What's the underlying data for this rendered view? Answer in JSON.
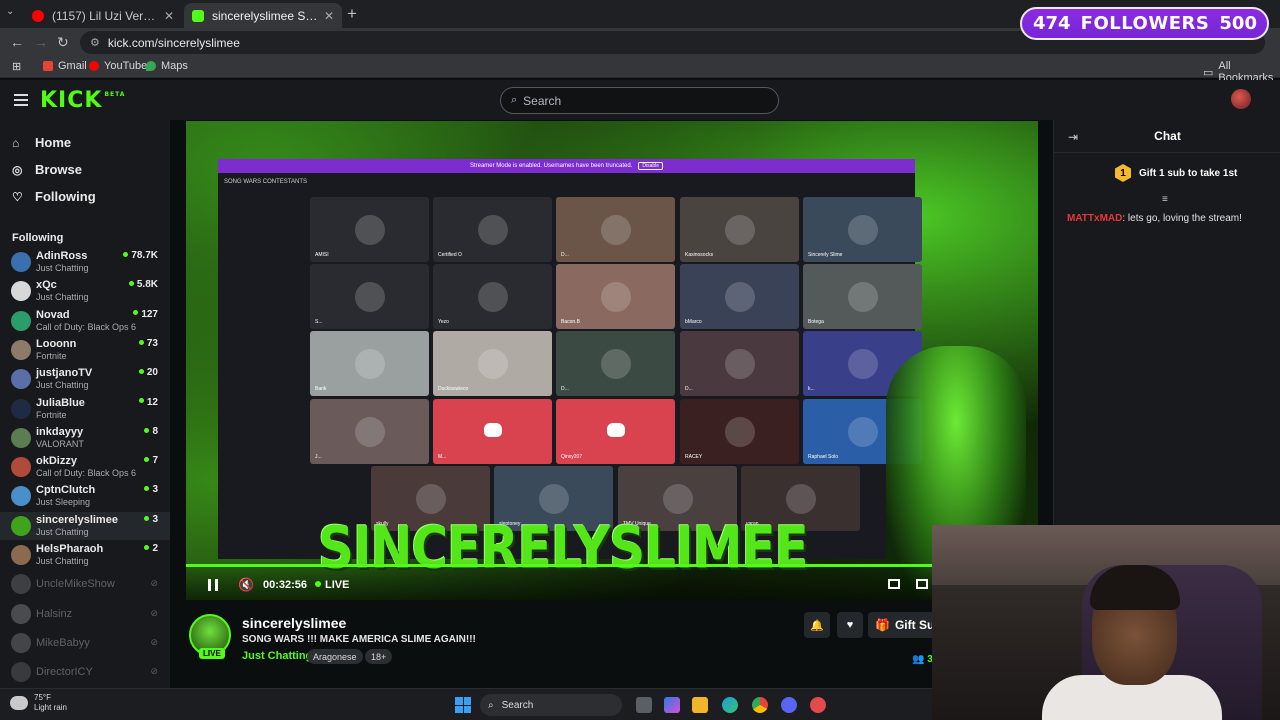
{
  "browser": {
    "tabs": [
      {
        "title": "(1157) Lil Uzi Vert - Alfa Romeo",
        "favicon_color": "#ff0000",
        "active": false
      },
      {
        "title": "sincerelyslimee Stream - W",
        "favicon_color": "#53fc18",
        "active": true
      }
    ],
    "url": "kick.com/sincerelyslimee",
    "bookmarks": [
      {
        "label": "Gmail",
        "color": "#ea4335"
      },
      {
        "label": "YouTube",
        "color": "#ff0000"
      },
      {
        "label": "Maps",
        "color": "#34a853"
      }
    ],
    "all_bookmarks": "All Bookmarks"
  },
  "overlay": {
    "followers_current": "474",
    "followers_label": "FOLLOWERS",
    "followers_goal": "500"
  },
  "header": {
    "logo": "KICK",
    "logo_badge": "BETA",
    "search_placeholder": "Search"
  },
  "sidebar": {
    "nav": [
      {
        "label": "Home",
        "icon": "home-icon"
      },
      {
        "label": "Browse",
        "icon": "compass-icon"
      },
      {
        "label": "Following",
        "icon": "heart-icon"
      }
    ],
    "following_heading": "Following",
    "channels": [
      {
        "name": "AdinRoss",
        "category": "Just Chatting",
        "viewers": "78.7K",
        "color": "#3a6fb0"
      },
      {
        "name": "xQc",
        "category": "Just Chatting",
        "viewers": "5.8K",
        "color": "#d8d8d8"
      },
      {
        "name": "Novad",
        "category": "Call of Duty: Black Ops 6",
        "viewers": "127",
        "color": "#2a9d6a"
      },
      {
        "name": "Looonn",
        "category": "Fortnite",
        "viewers": "73",
        "color": "#8c7a6b"
      },
      {
        "name": "justjanoTV",
        "category": "Just Chatting",
        "viewers": "20",
        "color": "#5a6fa8"
      },
      {
        "name": "JuliaBlue",
        "category": "Fortnite",
        "viewers": "12",
        "color": "#1f2a44"
      },
      {
        "name": "inkdayyy",
        "category": "VALORANT",
        "viewers": "8",
        "color": "#5b7d52"
      },
      {
        "name": "okDizzy",
        "category": "Call of Duty: Black Ops 6",
        "viewers": "7",
        "color": "#b04a3a"
      },
      {
        "name": "CptnClutch",
        "category": "Just Sleeping",
        "viewers": "3",
        "color": "#4a8fc8"
      },
      {
        "name": "sincerelyslimee",
        "category": "Just Chatting",
        "viewers": "3",
        "color": "#3fa31c",
        "active": true
      },
      {
        "name": "HelsPharaoh",
        "category": "Just Chatting",
        "viewers": "2",
        "color": "#8a6b4f"
      }
    ],
    "offline_channels": [
      {
        "name": "UncleMikeShow",
        "color": "#888888"
      },
      {
        "name": "Halsinz",
        "color": "#aaaaaa"
      },
      {
        "name": "MikeBabyy",
        "color": "#999999"
      },
      {
        "name": "DirectorICY",
        "color": "#777777"
      }
    ]
  },
  "player": {
    "streamer_mode_text": "Streamer Mode is enabled. Usernames have been truncated.",
    "disable_label": "Disable",
    "contestants_label": "SONG WARS CONTESTANTS",
    "tiles": [
      {
        "label": "AMISI",
        "color": "#2a2b30"
      },
      {
        "label": "Certified O",
        "color": "#2a2b30"
      },
      {
        "label": "D...",
        "color": "#6a5548"
      },
      {
        "label": "Kasinosocks",
        "color": "#4a4440"
      },
      {
        "label": "Sincerely Slime",
        "color": "#3a4a5a"
      },
      {
        "label": "S...",
        "color": "#2a2b30"
      },
      {
        "label": "Yezo",
        "color": "#2a2b30"
      },
      {
        "label": "Bacon.B",
        "color": "#8a6a60"
      },
      {
        "label": "bMarco",
        "color": "#3a4258"
      },
      {
        "label": "Botega",
        "color": "#545a5a"
      },
      {
        "label": "Bank",
        "color": "#9aa0a0"
      },
      {
        "label": "Duckisswieco",
        "color": "#b0aaa5"
      },
      {
        "label": "D...",
        "color": "#3c4a44"
      },
      {
        "label": "D...",
        "color": "#4a3a40"
      },
      {
        "label": "k...",
        "color": "#3a3f8a"
      },
      {
        "label": "J...",
        "color": "#6a5a5a"
      },
      {
        "label": "M...",
        "color": "#d9434f",
        "discord": true
      },
      {
        "label": "Qinxy207",
        "color": "#d9434f",
        "discord": true
      },
      {
        "label": "RACEY",
        "color": "#3a2020"
      },
      {
        "label": "Raphael Solo",
        "color": "#2a5fa8"
      },
      {
        "label": "skully",
        "color": "#4a3a3a"
      },
      {
        "label": "sleptoney",
        "color": "#3a4a5a"
      },
      {
        "label": "TMV Unique",
        "color": "#4a4040"
      },
      {
        "label": "varan",
        "color": "#3a3030"
      }
    ],
    "big_title": "SINCERELYSLIMEE",
    "time": "00:32:56",
    "live_label": "LIVE"
  },
  "stream": {
    "channel_name": "sincerelyslimee",
    "title": "SONG WARS  !!! MAKE AMERICA SLIME AGAIN!!!",
    "category": "Just Chatting",
    "tags": [
      "Aragonese",
      "18+"
    ],
    "live_pill": "LIVE",
    "gift_sub_label": "Gift Sub",
    "viewers": "3"
  },
  "chat": {
    "title": "Chat",
    "gift_rank": "1",
    "gift_text": "Gift 1 sub to take 1st",
    "messages": [
      {
        "user": "MATTxMAD",
        "text": ": lets go, loving the stream!"
      }
    ]
  },
  "taskbar": {
    "weather_temp": "75°F",
    "weather_desc": "Light rain",
    "search_label": "Search"
  }
}
